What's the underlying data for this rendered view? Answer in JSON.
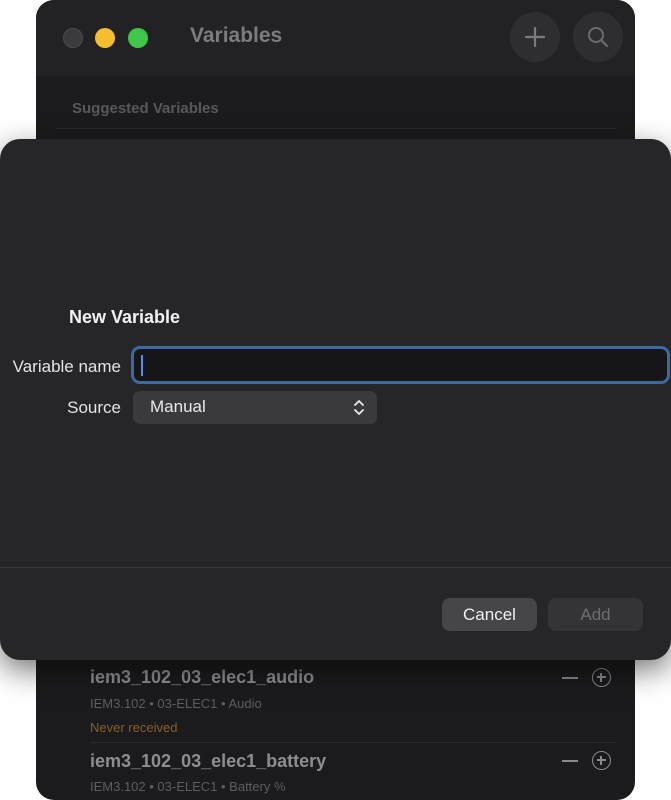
{
  "window": {
    "title": "Variables",
    "section_header": "Suggested Variables"
  },
  "dialog": {
    "title": "New Variable",
    "name_label": "Variable name",
    "name_value": "",
    "source_label": "Source",
    "source_value": "Manual",
    "cancel_label": "Cancel",
    "add_label": "Add"
  },
  "variables": [
    {
      "name": "iem3_102_03_elec1_audio",
      "meta": "IEM3.102 • 03-ELEC1 • Audio",
      "status": "Never received"
    },
    {
      "name": "iem3_102_03_elec1_battery",
      "meta": "IEM3.102 • 03-ELEC1 • Battery %"
    }
  ],
  "icons": {
    "add": "plus-icon",
    "search": "magnifier-icon",
    "row_remove": "minus-icon",
    "row_add": "circle-plus-icon",
    "select": "chevron-up-down-icon"
  },
  "colors": {
    "accent": "#3c6a9e",
    "caret": "#4e8ef7",
    "status_warning": "#8a5f28",
    "traffic_min": "#f6bd2f",
    "traffic_max": "#3ec74a"
  }
}
